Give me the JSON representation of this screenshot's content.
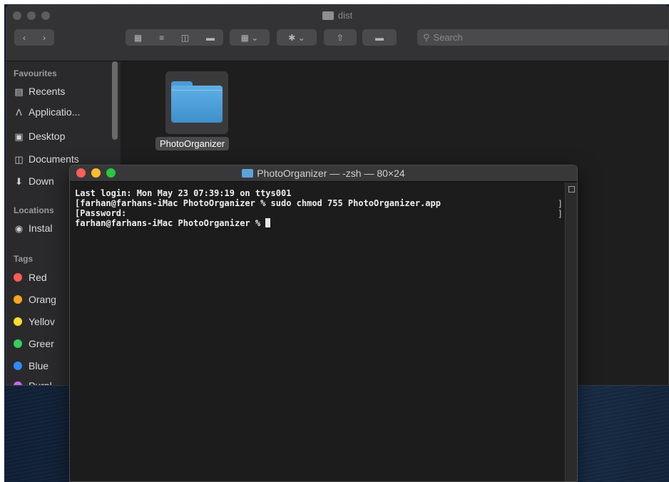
{
  "finder": {
    "title": "dist",
    "search_placeholder": "Search",
    "sidebar": {
      "favourites_header": "Favourites",
      "favourites": [
        {
          "label": "Recents",
          "icon": "recents-icon"
        },
        {
          "label": "Applicatio...",
          "icon": "applications-icon"
        },
        {
          "label": "Desktop",
          "icon": "desktop-icon"
        },
        {
          "label": "Documents",
          "icon": "documents-icon"
        },
        {
          "label": "Down",
          "icon": "downloads-icon"
        }
      ],
      "locations_header": "Locations",
      "locations": [
        {
          "label": "Instal",
          "icon": "disk-icon"
        }
      ],
      "tags_header": "Tags",
      "tags": [
        {
          "label": "Red",
          "color": "#ff5b56"
        },
        {
          "label": "Orang",
          "color": "#ffa61f"
        },
        {
          "label": "Yellov",
          "color": "#ffdc2e"
        },
        {
          "label": "Greer",
          "color": "#34d15a"
        },
        {
          "label": "Blue",
          "color": "#2f8bff"
        },
        {
          "label": "Purpl",
          "color": "#c06cf0"
        }
      ]
    },
    "items": [
      {
        "name": "PhotoOrganizer",
        "type": "folder"
      }
    ]
  },
  "terminal": {
    "title": "PhotoOrganizer — -zsh — 80×24",
    "lines": [
      "Last login: Mon May 23 07:39:19 on ttys001",
      "[farhan@farhans-iMac PhotoOrganizer % sudo chmod 755 PhotoOrganizer.app",
      "[Password:",
      "farhan@farhans-iMac PhotoOrganizer % "
    ]
  }
}
